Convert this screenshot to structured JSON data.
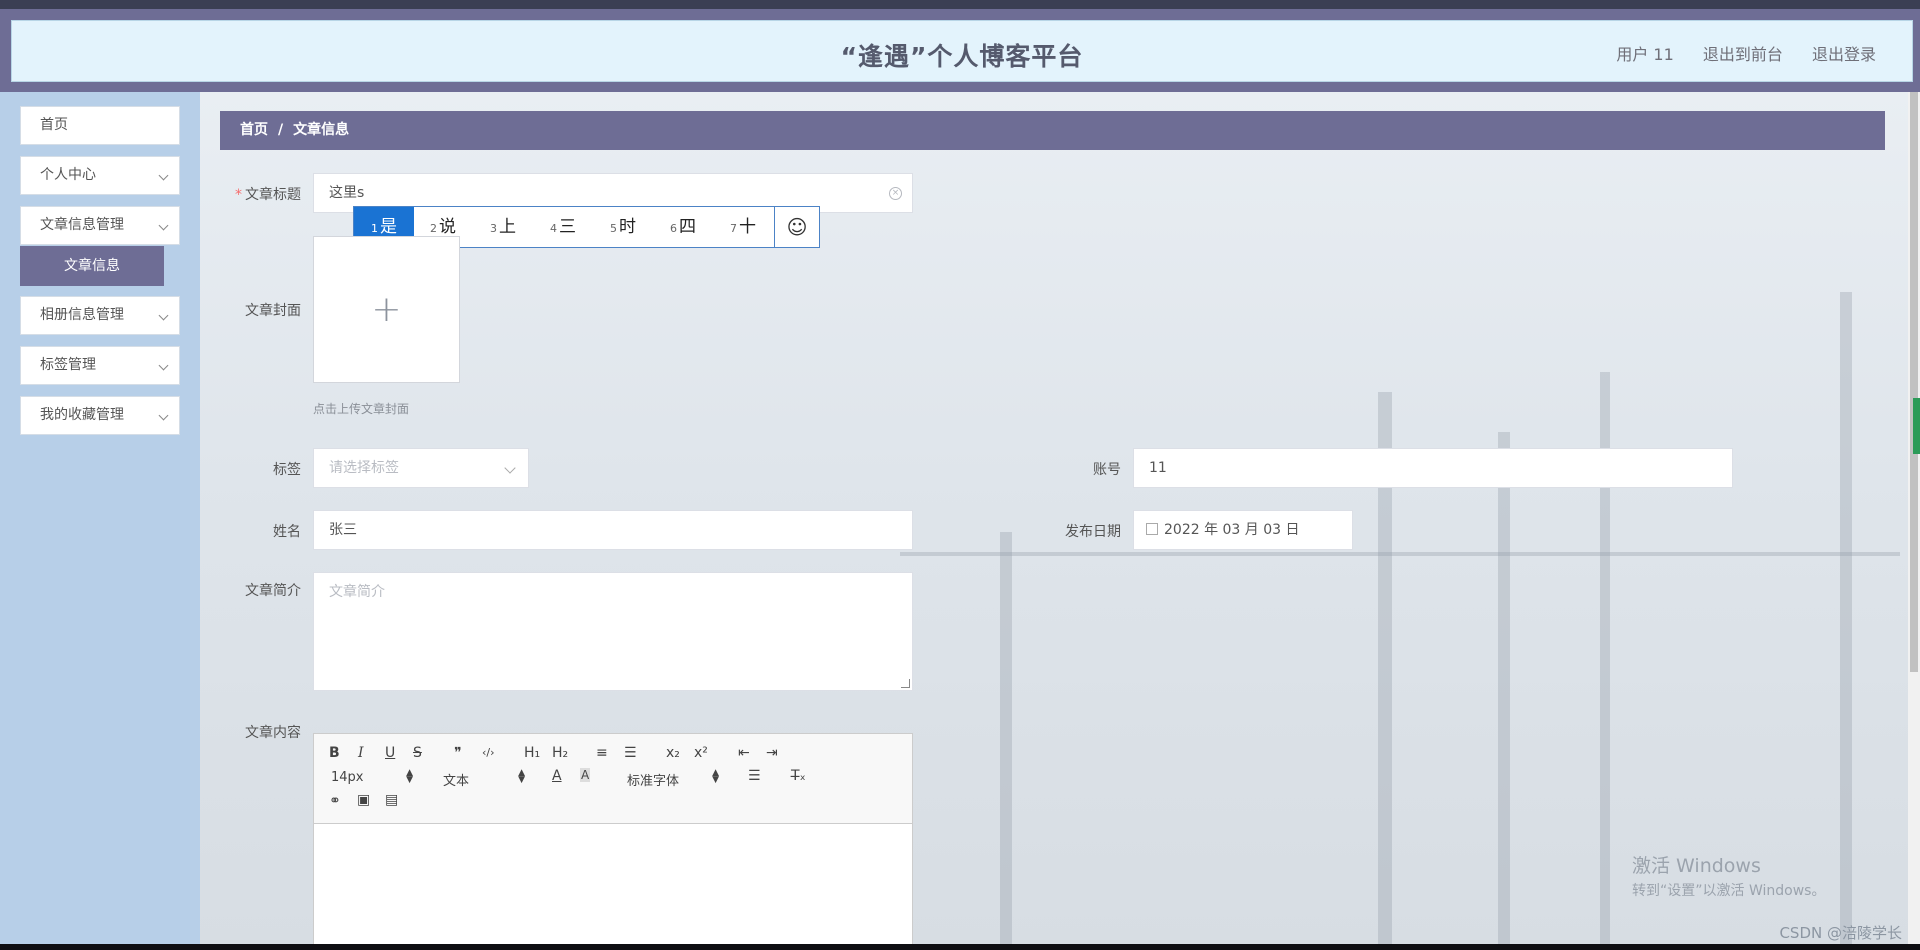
{
  "header": {
    "title": "“逢遇”个人博客平台",
    "user": "用户 11",
    "front_link": "退出到前台",
    "logout_link": "退出登录"
  },
  "sidebar": {
    "items": [
      {
        "label": "首页"
      },
      {
        "label": "个人中心"
      },
      {
        "label": "文章信息管理"
      },
      {
        "label": "相册信息管理"
      },
      {
        "label": "标签管理"
      },
      {
        "label": "我的收藏管理"
      }
    ],
    "active_sub": "文章信息"
  },
  "breadcrumb": {
    "home": "首页",
    "sep": "/",
    "current": "文章信息"
  },
  "form": {
    "title_label": "文章标题",
    "title_value": "这里s",
    "cover_label": "文章封面",
    "cover_hint": "点击上传文章封面",
    "tag_label": "标签",
    "tag_placeholder": "请选择标签",
    "account_label": "账号",
    "account_value": "11",
    "name_label": "姓名",
    "name_value": "张三",
    "date_label": "发布日期",
    "date_value": "2022 年 03 月 03 日",
    "summary_label": "文章简介",
    "summary_placeholder": "文章简介",
    "content_label": "文章内容"
  },
  "ime": {
    "candidates": [
      {
        "num": "1",
        "text": "是"
      },
      {
        "num": "2",
        "text": "说"
      },
      {
        "num": "3",
        "text": "上"
      },
      {
        "num": "4",
        "text": "三"
      },
      {
        "num": "5",
        "text": "时"
      },
      {
        "num": "6",
        "text": "四"
      },
      {
        "num": "7",
        "text": "十"
      }
    ],
    "selected_index": 0,
    "emoji": "☺"
  },
  "editor": {
    "row1": [
      "B",
      "I",
      "U",
      "S",
      "❞",
      "‹/›",
      "H₁",
      "H₂",
      "≡",
      "☰",
      "x₂",
      "x²",
      "⇤",
      "⇥"
    ],
    "font_size": "14px",
    "block_type": "文本",
    "font_family": "标准字体",
    "row3_icons": [
      "link-icon",
      "image-icon",
      "video-icon"
    ]
  },
  "watermark": {
    "line1": "激活 Windows",
    "line2": "转到“设置”以激活 Windows。"
  },
  "credit": "CSDN @涪陵学长"
}
